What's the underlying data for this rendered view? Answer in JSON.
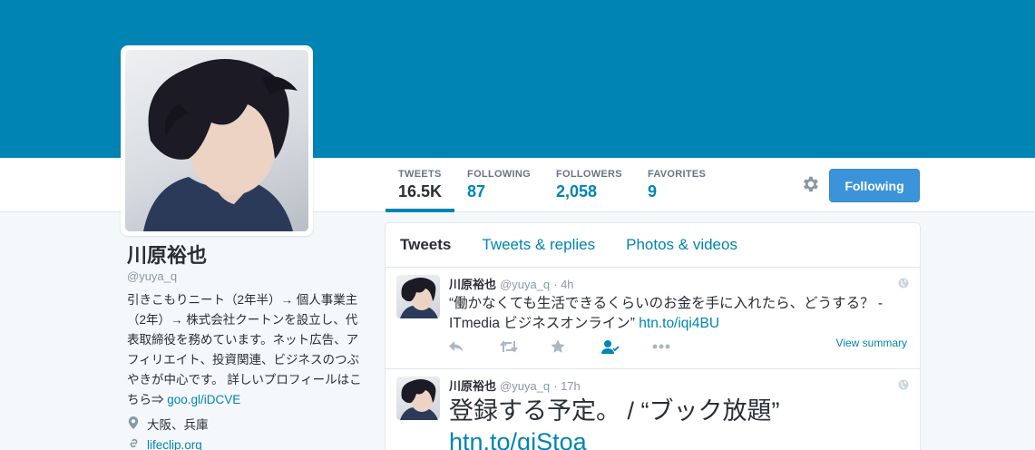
{
  "profile": {
    "name": "川原裕也",
    "handle": "@yuya_q",
    "bio_text": "引きこもりニート（2年半）→ 個人事業主（2年）→ 株式会社クートンを設立し、代表取締役を務めています。ネット広告、アフィリエイト、投資関連、ビジネスのつぶやきが中心です。 詳しいプロフィールはこちら⇒ ",
    "bio_link": "goo.gl/iDCVE",
    "location": "大阪、兵庫",
    "website": "lifeclip.org"
  },
  "stats": [
    {
      "label": "TWEETS",
      "value": "16.5K"
    },
    {
      "label": "FOLLOWING",
      "value": "87"
    },
    {
      "label": "FOLLOWERS",
      "value": "2,058"
    },
    {
      "label": "FAVORITES",
      "value": "9"
    }
  ],
  "follow_button": "Following",
  "tabs": [
    "Tweets",
    "Tweets & replies",
    "Photos & videos"
  ],
  "tweets": [
    {
      "name": "川原裕也",
      "handle": "@yuya_q",
      "time": "· 4h",
      "text": "“働かなくても生活できるくらいのお金を手に入れたら、どうする？ - ITmedia ビジネスオンライン” ",
      "link": "htn.to/iqi4BU",
      "view_summary": "View summary"
    },
    {
      "name": "川原裕也",
      "handle": "@yuya_q",
      "time": "· 17h",
      "text": "登録する予定。 / “ブック放題”",
      "link": "htn.to/giStoa"
    }
  ],
  "colors": {
    "banner": "#0084b4",
    "accent": "#0084b4",
    "button": "#3b94d9"
  }
}
